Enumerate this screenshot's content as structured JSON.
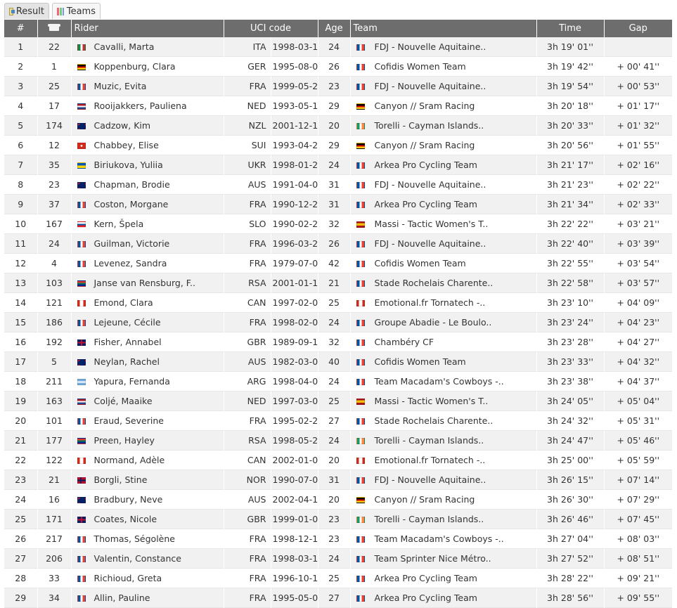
{
  "tabs": [
    {
      "label": "Result",
      "icon": "result-icon"
    },
    {
      "label": "Teams",
      "icon": "teams-icon"
    }
  ],
  "columns": {
    "rank": "#",
    "bib_icon": "jersey-icon",
    "rider": "Rider",
    "uci": "UCI code",
    "age": "Age",
    "team": "Team",
    "time": "Time",
    "gap": "Gap"
  },
  "rows": [
    {
      "rank": "1",
      "bib": "22",
      "flag": "it",
      "rider": "Cavalli, Marta",
      "nat": "ITA",
      "dob": "1998-03-18",
      "age": "24",
      "tflag": "fr",
      "team": "FDJ - Nouvelle Aquitaine..",
      "time": "3h 19' 01''",
      "gap": ""
    },
    {
      "rank": "2",
      "bib": "1",
      "flag": "de",
      "rider": "Koppenburg, Clara",
      "nat": "GER",
      "dob": "1995-08-03",
      "age": "26",
      "tflag": "fr",
      "team": "Cofidis Women Team",
      "time": "3h 19' 42''",
      "gap": "+ 00' 41''"
    },
    {
      "rank": "3",
      "bib": "25",
      "flag": "fr",
      "rider": "Muzic, Evita",
      "nat": "FRA",
      "dob": "1999-05-26",
      "age": "23",
      "tflag": "fr",
      "team": "FDJ - Nouvelle Aquitaine..",
      "time": "3h 19' 54''",
      "gap": "+ 00' 53''"
    },
    {
      "rank": "4",
      "bib": "17",
      "flag": "nl",
      "rider": "Rooijakkers, Pauliena",
      "nat": "NED",
      "dob": "1993-05-12",
      "age": "29",
      "tflag": "de",
      "team": "Canyon // Sram Racing",
      "time": "3h 20' 18''",
      "gap": "+ 01' 17''"
    },
    {
      "rank": "5",
      "bib": "174",
      "flag": "nz",
      "rider": "Cadzow, Kim",
      "nat": "NZL",
      "dob": "2001-12-18",
      "age": "20",
      "tflag": "ie",
      "team": "Torelli - Cayman Islands..",
      "time": "3h 20' 33''",
      "gap": "+ 01' 32''"
    },
    {
      "rank": "6",
      "bib": "12",
      "flag": "ch",
      "rider": "Chabbey, Elise",
      "nat": "SUI",
      "dob": "1993-04-24",
      "age": "29",
      "tflag": "de",
      "team": "Canyon // Sram Racing",
      "time": "3h 20' 56''",
      "gap": "+ 01' 55''"
    },
    {
      "rank": "7",
      "bib": "35",
      "flag": "ua",
      "rider": "Biriukova, Yuliia",
      "nat": "UKR",
      "dob": "1998-01-24",
      "age": "24",
      "tflag": "fr",
      "team": "Arkea Pro Cycling Team",
      "time": "3h 21' 17''",
      "gap": "+ 02' 16''"
    },
    {
      "rank": "8",
      "bib": "23",
      "flag": "au",
      "rider": "Chapman, Brodie",
      "nat": "AUS",
      "dob": "1991-04-09",
      "age": "31",
      "tflag": "fr",
      "team": "FDJ - Nouvelle Aquitaine..",
      "time": "3h 21' 23''",
      "gap": "+ 02' 22''"
    },
    {
      "rank": "9",
      "bib": "37",
      "flag": "fr",
      "rider": "Coston, Morgane",
      "nat": "FRA",
      "dob": "1990-12-28",
      "age": "31",
      "tflag": "fr",
      "team": "Arkea Pro Cycling Team",
      "time": "3h 21' 34''",
      "gap": "+ 02' 33''"
    },
    {
      "rank": "10",
      "bib": "167",
      "flag": "si",
      "rider": "Kern, Špela",
      "nat": "SLO",
      "dob": "1990-02-24",
      "age": "32",
      "tflag": "es",
      "team": "Massi - Tactic Women's T..",
      "time": "3h 22' 22''",
      "gap": "+ 03' 21''"
    },
    {
      "rank": "11",
      "bib": "24",
      "flag": "fr",
      "rider": "Guilman, Victorie",
      "nat": "FRA",
      "dob": "1996-03-25",
      "age": "26",
      "tflag": "fr",
      "team": "FDJ - Nouvelle Aquitaine..",
      "time": "3h 22' 40''",
      "gap": "+ 03' 39''"
    },
    {
      "rank": "12",
      "bib": "4",
      "flag": "fr",
      "rider": "Levenez, Sandra",
      "nat": "FRA",
      "dob": "1979-07-05",
      "age": "42",
      "tflag": "fr",
      "team": "Cofidis Women Team",
      "time": "3h 22' 55''",
      "gap": "+ 03' 54''"
    },
    {
      "rank": "13",
      "bib": "103",
      "flag": "za",
      "rider": "Janse van Rensburg, F..",
      "nat": "RSA",
      "dob": "2001-01-10",
      "age": "21",
      "tflag": "fr",
      "team": "Stade Rochelais Charente..",
      "time": "3h 22' 58''",
      "gap": "+ 03' 57''"
    },
    {
      "rank": "14",
      "bib": "121",
      "flag": "ca",
      "rider": "Emond, Clara",
      "nat": "CAN",
      "dob": "1997-02-05",
      "age": "25",
      "tflag": "ca",
      "team": "Emotional.fr Tornatech -..",
      "time": "3h 23' 10''",
      "gap": "+ 04' 09''"
    },
    {
      "rank": "15",
      "bib": "186",
      "flag": "fr",
      "rider": "Lejeune, Cécile",
      "nat": "FRA",
      "dob": "1998-02-01",
      "age": "24",
      "tflag": "fr",
      "team": "Groupe Abadie - Le Boulo..",
      "time": "3h 23' 24''",
      "gap": "+ 04' 23''"
    },
    {
      "rank": "16",
      "bib": "192",
      "flag": "gb",
      "rider": "Fisher, Annabel",
      "nat": "GBR",
      "dob": "1989-09-19",
      "age": "32",
      "tflag": "fr",
      "team": "Chambéry CF",
      "time": "3h 23' 28''",
      "gap": "+ 04' 27''"
    },
    {
      "rank": "17",
      "bib": "5",
      "flag": "au",
      "rider": "Neylan, Rachel",
      "nat": "AUS",
      "dob": "1982-03-09",
      "age": "40",
      "tflag": "fr",
      "team": "Cofidis Women Team",
      "time": "3h 23' 33''",
      "gap": "+ 04' 32''"
    },
    {
      "rank": "18",
      "bib": "211",
      "flag": "ar",
      "rider": "Yapura, Fernanda",
      "nat": "ARG",
      "dob": "1998-04-06",
      "age": "24",
      "tflag": "fr",
      "team": "Team Macadam's Cowboys -..",
      "time": "3h 23' 38''",
      "gap": "+ 04' 37''"
    },
    {
      "rank": "19",
      "bib": "163",
      "flag": "nl",
      "rider": "Coljé, Maaike",
      "nat": "NED",
      "dob": "1997-03-07",
      "age": "25",
      "tflag": "es",
      "team": "Massi - Tactic Women's T..",
      "time": "3h 24' 05''",
      "gap": "+ 05' 04''"
    },
    {
      "rank": "20",
      "bib": "101",
      "flag": "fr",
      "rider": "Eraud, Severine",
      "nat": "FRA",
      "dob": "1995-02-24",
      "age": "27",
      "tflag": "fr",
      "team": "Stade Rochelais Charente..",
      "time": "3h 24' 32''",
      "gap": "+ 05' 31''"
    },
    {
      "rank": "21",
      "bib": "177",
      "flag": "za",
      "rider": "Preen, Hayley",
      "nat": "RSA",
      "dob": "1998-05-28",
      "age": "24",
      "tflag": "ie",
      "team": "Torelli - Cayman Islands..",
      "time": "3h 24' 47''",
      "gap": "+ 05' 46''"
    },
    {
      "rank": "22",
      "bib": "122",
      "flag": "ca",
      "rider": "Normand, Adèle",
      "nat": "CAN",
      "dob": "2002-01-05",
      "age": "20",
      "tflag": "ca",
      "team": "Emotional.fr Tornatech -..",
      "time": "3h 25' 00''",
      "gap": "+ 05' 59''"
    },
    {
      "rank": "23",
      "bib": "21",
      "flag": "no",
      "rider": "Borgli, Stine",
      "nat": "NOR",
      "dob": "1990-07-04",
      "age": "31",
      "tflag": "fr",
      "team": "FDJ - Nouvelle Aquitaine..",
      "time": "3h 26' 15''",
      "gap": "+ 07' 14''"
    },
    {
      "rank": "24",
      "bib": "16",
      "flag": "au",
      "rider": "Bradbury, Neve",
      "nat": "AUS",
      "dob": "2002-04-11",
      "age": "20",
      "tflag": "de",
      "team": "Canyon // Sram Racing",
      "time": "3h 26' 30''",
      "gap": "+ 07' 29''"
    },
    {
      "rank": "25",
      "bib": "171",
      "flag": "gb",
      "rider": "Coates, Nicole",
      "nat": "GBR",
      "dob": "1999-01-02",
      "age": "23",
      "tflag": "ie",
      "team": "Torelli - Cayman Islands..",
      "time": "3h 26' 46''",
      "gap": "+ 07' 45''"
    },
    {
      "rank": "26",
      "bib": "217",
      "flag": "fr",
      "rider": "Thomas, Ségolène",
      "nat": "FRA",
      "dob": "1998-12-17",
      "age": "23",
      "tflag": "fr",
      "team": "Team Macadam's Cowboys -..",
      "time": "3h 27' 04''",
      "gap": "+ 08' 03''"
    },
    {
      "rank": "27",
      "bib": "206",
      "flag": "fr",
      "rider": "Valentin, Constance",
      "nat": "FRA",
      "dob": "1998-03-19",
      "age": "24",
      "tflag": "fr",
      "team": "Team Sprinter Nice Métro..",
      "time": "3h 27' 52''",
      "gap": "+ 08' 51''"
    },
    {
      "rank": "28",
      "bib": "33",
      "flag": "fr",
      "rider": "Richioud, Greta",
      "nat": "FRA",
      "dob": "1996-10-11",
      "age": "25",
      "tflag": "fr",
      "team": "Arkea Pro Cycling Team",
      "time": "3h 28' 22''",
      "gap": "+ 09' 21''"
    },
    {
      "rank": "29",
      "bib": "34",
      "flag": "fr",
      "rider": "Allin, Pauline",
      "nat": "FRA",
      "dob": "1995-05-02",
      "age": "27",
      "tflag": "fr",
      "team": "Arkea Pro Cycling Team",
      "time": "3h 28' 56''",
      "gap": "+ 09' 55''"
    }
  ],
  "flag_colors": {
    "it": "linear-gradient(90deg,#009246 33%,#fff 33% 66%,#ce2b37 66%)",
    "fr": "linear-gradient(90deg,#0055a4 33%,#fff 33% 66%,#ef4135 66%)",
    "de": "linear-gradient(180deg,#000 33%,#dd0000 33% 66%,#ffce00 66%)",
    "nl": "linear-gradient(180deg,#ae1c28 33%,#fff 33% 66%,#21468b 66%)",
    "nz": "linear-gradient(135deg,#b22 0 20%,#012169 20%)",
    "ch": "radial-gradient(circle,#fff 22%,#d52b1e 24%)",
    "ua": "linear-gradient(180deg,#0057b7 50%,#ffd700 50%)",
    "au": "linear-gradient(135deg,#c8102e 0 20%,#012169 20%)",
    "si": "linear-gradient(180deg,#fff 33%,#0056a6 33% 66%,#ed1c24 66%)",
    "za": "linear-gradient(180deg,#de3831 33%,#fff 33% 38%,#007a4d 38% 62%,#fff 62% 67%,#002395 67%)",
    "ca": "linear-gradient(90deg,#d52b1e 25%,#fff 25% 75%,#d52b1e 75%)",
    "gb": "linear-gradient(90deg,transparent 40%,#c8102e 40% 60%,transparent 60%),linear-gradient(180deg,#012169 38%,#c8102e 38% 62%,#012169 62%)",
    "ar": "linear-gradient(180deg,#74acdf 33%,#fff 33% 66%,#74acdf 66%)",
    "no": "linear-gradient(90deg,transparent 30%,#00205b 30% 45%,transparent 45%),linear-gradient(180deg,#ba0c2f 38%,#00205b 38% 62%,#ba0c2f 62%)",
    "ie": "linear-gradient(90deg,#169b62 33%,#fff 33% 66%,#ff883e 66%)",
    "es": "linear-gradient(180deg,#aa151b 25%,#f1bf00 25% 75%,#aa151b 75%)"
  }
}
